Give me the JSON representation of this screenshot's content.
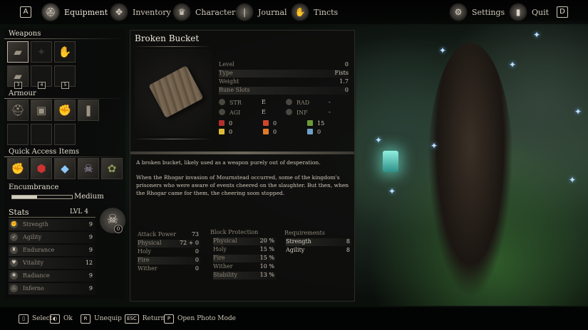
{
  "topbar": {
    "left_key": "A",
    "right_key": "D",
    "tabs": [
      {
        "label": "Equipment",
        "icon": "helmet-icon",
        "active": true
      },
      {
        "label": "Inventory",
        "icon": "bag-icon"
      },
      {
        "label": "Character",
        "icon": "crown-icon"
      },
      {
        "label": "Journal",
        "icon": "book-icon"
      },
      {
        "label": "Tincts",
        "icon": "hand-icon"
      }
    ],
    "settings_label": "Settings",
    "quit_label": "Quit"
  },
  "left": {
    "weapons_label": "Weapons",
    "weapon_slot_numbers": [
      "3",
      "4",
      "5"
    ],
    "armour_label": "Armour",
    "quick_access_label": "Quick Access Items",
    "encumbrance_label": "Encumbrance",
    "encumbrance_value": "Medium",
    "encumbrance_fill": 0.42,
    "stats_label": "Stats",
    "level_label": "LVL 4",
    "stats": [
      {
        "name": "Strength",
        "value": "9"
      },
      {
        "name": "Agility",
        "value": "9"
      },
      {
        "name": "Endurance",
        "value": "9"
      },
      {
        "name": "Vitality",
        "value": "12"
      },
      {
        "name": "Radiance",
        "value": "9"
      },
      {
        "name": "Inferno",
        "value": "9"
      }
    ],
    "skull_count": "0"
  },
  "item": {
    "title": "Broken Bucket",
    "properties": [
      {
        "name": "Level",
        "value": "0"
      },
      {
        "name": "Type",
        "value": "Fists"
      },
      {
        "name": "Weight",
        "value": "1.7"
      },
      {
        "name": "Rune Slots",
        "value": "0"
      }
    ],
    "scaling": [
      {
        "name": "STR",
        "value": "E"
      },
      {
        "name": "RAD",
        "value": "-"
      },
      {
        "name": "AGI",
        "value": "E"
      },
      {
        "name": "INF",
        "value": "-"
      }
    ],
    "resist_values": [
      "0",
      "0",
      "15",
      "0",
      "0",
      "0"
    ],
    "description": [
      "A broken bucket, likely used as a weapon purely out of desperation.",
      "When the Rhogar invasion of Mournstead occurred, some of the kingdom's prisoners who were aware of events cheered on the slaughter. But then, when the Rhogar came for them, the cheering soon stopped."
    ],
    "attack_power_label": "Attack Power",
    "attack_power_value": "73",
    "attack_rows": [
      {
        "name": "Physical",
        "value": "72 + 0"
      },
      {
        "name": "Holy",
        "value": "0"
      },
      {
        "name": "Fire",
        "value": "0"
      },
      {
        "name": "Wither",
        "value": "0"
      }
    ],
    "block_label": "Block Protection",
    "block_rows": [
      {
        "name": "Physical",
        "value": "20 %"
      },
      {
        "name": "Holy",
        "value": "15 %"
      },
      {
        "name": "Fire",
        "value": "15 %"
      },
      {
        "name": "Wither",
        "value": "10 %"
      },
      {
        "name": "Stability",
        "value": "13 %"
      }
    ],
    "requirements_label": "Requirements",
    "requirements": [
      {
        "name": "Strength",
        "value": "8"
      },
      {
        "name": "Agility",
        "value": "8"
      }
    ]
  },
  "footer": [
    {
      "key": "",
      "label": "Select"
    },
    {
      "key": "",
      "label": "Ok"
    },
    {
      "key": "R",
      "label": "Unequip"
    },
    {
      "key": "ESC",
      "label": "Return"
    },
    {
      "key": "P",
      "label": "Open Photo Mode"
    }
  ]
}
